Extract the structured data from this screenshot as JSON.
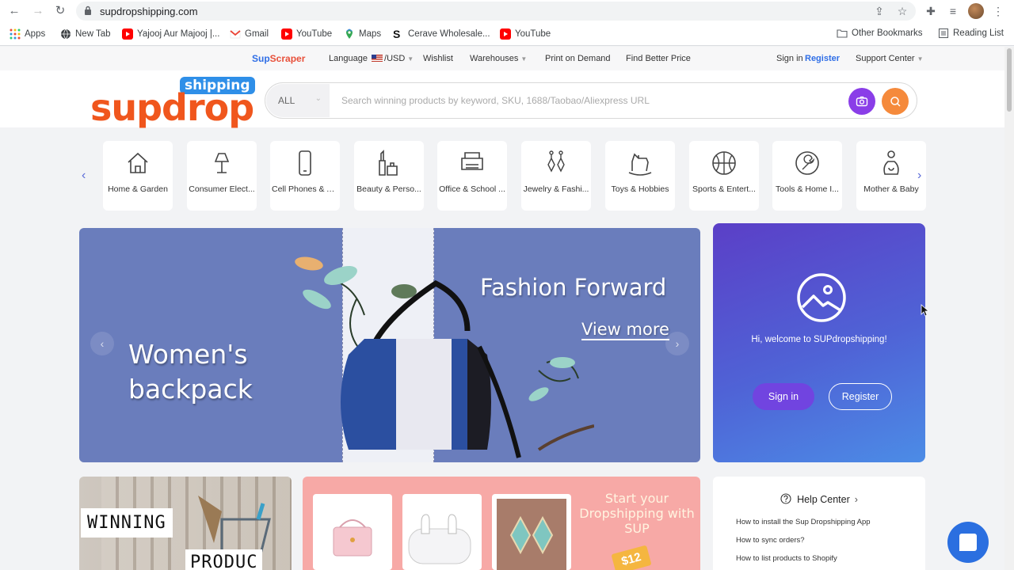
{
  "browser": {
    "url": "supdropshipping.com",
    "bookmarks": [
      {
        "label": "Apps",
        "icon": "apps-grid-icon"
      },
      {
        "label": "New Tab",
        "icon": "globe-icon"
      },
      {
        "label": "Yajooj Aur Majooj |...",
        "icon": "youtube-icon"
      },
      {
        "label": "Gmail",
        "icon": "gmail-icon"
      },
      {
        "label": "YouTube",
        "icon": "youtube-icon"
      },
      {
        "label": "Maps",
        "icon": "maps-icon"
      },
      {
        "label": "Cerave Wholesale...",
        "icon": "s-logo-icon"
      },
      {
        "label": "YouTube",
        "icon": "youtube-icon"
      }
    ],
    "other_bookmarks": "Other Bookmarks",
    "reading_list": "Reading List"
  },
  "topbar": {
    "brand_sup": "Sup",
    "brand_scraper": "Scraper",
    "language": "Language",
    "currency": "/USD",
    "wishlist": "Wishlist",
    "warehouses": "Warehouses",
    "print_on_demand": "Print on Demand",
    "find_better_price": "Find Better Price",
    "sign_in": "Sign in",
    "register": "Register",
    "support_center": "Support Center"
  },
  "header": {
    "logo_badge": "shipping",
    "logo_text": "supdrop",
    "search_category": "ALL",
    "search_placeholder": "Search winning products by keyword, SKU, 1688/Taobao/Aliexpress URL"
  },
  "categories": [
    {
      "label": "Home & Garden",
      "icon": "house-icon"
    },
    {
      "label": "Consumer Elect...",
      "icon": "lamp-icon"
    },
    {
      "label": "Cell Phones & A...",
      "icon": "phone-icon"
    },
    {
      "label": "Beauty & Perso...",
      "icon": "cosmetics-icon"
    },
    {
      "label": "Office & School ...",
      "icon": "printer-icon"
    },
    {
      "label": "Jewelry & Fashi...",
      "icon": "earrings-icon"
    },
    {
      "label": "Toys & Hobbies",
      "icon": "rocking-horse-icon"
    },
    {
      "label": "Sports & Entert...",
      "icon": "basketball-icon"
    },
    {
      "label": "Tools & Home I...",
      "icon": "wrench-icon"
    },
    {
      "label": "Mother & Baby",
      "icon": "baby-icon"
    }
  ],
  "banner": {
    "left_line1": "Women's",
    "left_line2": "backpack",
    "headline": "Fashion Forward",
    "cta": "View more"
  },
  "welcome": {
    "message": "Hi, welcome to SUPdropshipping!",
    "sign_in": "Sign in",
    "register": "Register"
  },
  "winning": {
    "line1": "WINNING",
    "line2": "PRODUC"
  },
  "promo": {
    "text": "Start your Dropshipping with SUP",
    "price_tag": "$12"
  },
  "help": {
    "title": "Help Center",
    "links": [
      "How to install the Sup Dropshipping App",
      "How to sync orders?",
      "How to list products to Shopify"
    ]
  },
  "colors": {
    "brand_orange": "#f0561d",
    "brand_blue": "#2f8fe8",
    "register_blue": "#2f6ee6",
    "welcome_gradient_start": "#5b3fc7",
    "welcome_gradient_end": "#4c8ce6",
    "banner_blue": "#6a7dbc"
  }
}
